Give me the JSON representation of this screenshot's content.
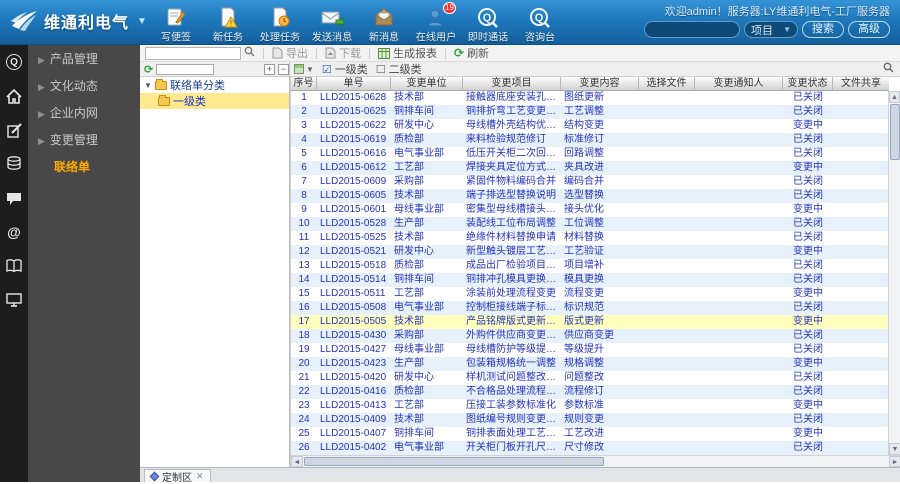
{
  "colors": {
    "header_blue": "#1e78bb",
    "accent_orange": "#ffa800",
    "link_blue": "#2333bd",
    "row_alt": "#e7f1fb",
    "row_highlight": "#ffffbe",
    "tree_selected": "#ffe98f"
  },
  "header": {
    "logo_text": "维通利电气",
    "welcome": "欢迎admin！服务器:LY维通利电气-工厂服务器",
    "search": {
      "value": "",
      "category": "项目",
      "search_btn": "搜索",
      "advanced_btn": "高级"
    },
    "tools": [
      {
        "label": "写便签",
        "badge": ""
      },
      {
        "label": "新任务",
        "badge": ""
      },
      {
        "label": "处理任务",
        "badge": ""
      },
      {
        "label": "发送消息",
        "badge": ""
      },
      {
        "label": "新消息",
        "badge": ""
      },
      {
        "label": "在线用户",
        "badge": "19"
      },
      {
        "label": "即时通话",
        "badge": ""
      },
      {
        "label": "咨询台",
        "badge": ""
      }
    ]
  },
  "sidebar": {
    "items": [
      {
        "label": "产品管理"
      },
      {
        "label": "文化动态"
      },
      {
        "label": "企业内网"
      },
      {
        "label": "变更管理"
      }
    ],
    "active_item": "联络单"
  },
  "content_toolbar": {
    "quick_search_value": "",
    "buttons": [
      {
        "label": "导出",
        "enabled": false
      },
      {
        "label": "下载",
        "enabled": false
      },
      {
        "label": "生成报表",
        "enabled": true
      },
      {
        "label": "刷新",
        "enabled": true
      }
    ],
    "filters": [
      {
        "label": "一级类",
        "checked": true
      },
      {
        "label": "二级类",
        "checked": false
      }
    ]
  },
  "tree": {
    "root": "联络单分类",
    "selected_node": "一级类",
    "filter_value": "",
    "bottom_tab": "定制区"
  },
  "table": {
    "headers": [
      "序号",
      "单号",
      "变更单位",
      "变更项目",
      "变更内容",
      "选择文件",
      "变更通知人",
      "变更状态",
      "文件共享"
    ],
    "highlighted_row_index": 16,
    "rows": [
      [
        "1",
        "LLD2015-0628",
        "技术部",
        "接触器底座安装孔位调整",
        "图纸更新",
        "",
        "",
        "已关闭",
        ""
      ],
      [
        "2",
        "LLD2015-0625",
        "铜排车间",
        "铜排折弯工艺变更通知",
        "工艺调整",
        "",
        "",
        "已关闭",
        ""
      ],
      [
        "3",
        "LLD2015-0622",
        "研发中心",
        "母线槽外壳结构优化方案…",
        "结构变更",
        "",
        "",
        "变更中",
        ""
      ],
      [
        "4",
        "LLD2015-0619",
        "质检部",
        "来料检验规范修订",
        "标准修订",
        "",
        "",
        "已关闭",
        ""
      ],
      [
        "5",
        "LLD2015-0616",
        "电气事业部",
        "低压开关柜二次回路调整…",
        "回路调整",
        "",
        "",
        "已关闭",
        ""
      ],
      [
        "6",
        "LLD2015-0612",
        "工艺部",
        "焊接夹具定位方式改进",
        "夹具改进",
        "",
        "",
        "变更中",
        ""
      ],
      [
        "7",
        "LLD2015-0609",
        "采购部",
        "紧固件物料编码合并",
        "编码合并",
        "",
        "",
        "已关闭",
        ""
      ],
      [
        "8",
        "LLD2015-0605",
        "技术部",
        "端子排选型替换说明",
        "选型替换",
        "",
        "",
        "已关闭",
        ""
      ],
      [
        "9",
        "LLD2015-0601",
        "母线事业部",
        "密集型母线槽接头优化",
        "接头优化",
        "",
        "",
        "变更中",
        ""
      ],
      [
        "10",
        "LLD2015-0528",
        "生产部",
        "装配线工位布局调整",
        "工位调整",
        "",
        "",
        "已关闭",
        ""
      ],
      [
        "11",
        "LLD2015-0525",
        "技术部",
        "绝缘件材料替换申请",
        "材料替换",
        "",
        "",
        "已关闭",
        ""
      ],
      [
        "12",
        "LLD2015-0521",
        "研发中心",
        "新型触头镀层工艺验证…",
        "工艺验证",
        "",
        "",
        "变更中",
        ""
      ],
      [
        "13",
        "LLD2015-0518",
        "质检部",
        "成品出厂检验项目增补",
        "项目增补",
        "",
        "",
        "已关闭",
        ""
      ],
      [
        "14",
        "LLD2015-0514",
        "铜排车间",
        "铜排冲孔模具更换通知",
        "模具更换",
        "",
        "",
        "已关闭",
        ""
      ],
      [
        "15",
        "LLD2015-0511",
        "工艺部",
        "涂装前处理流程变更",
        "流程变更",
        "",
        "",
        "变更中",
        ""
      ],
      [
        "16",
        "LLD2015-0508",
        "电气事业部",
        "控制柜接线端子标识规范",
        "标识规范",
        "",
        "",
        "已关闭",
        ""
      ],
      [
        "17",
        "LLD2015-0505",
        "技术部",
        "产品铭牌版式更新通知",
        "版式更新",
        "",
        "",
        "变更中",
        ""
      ],
      [
        "18",
        "LLD2015-0430",
        "采购部",
        "外购件供应商变更评审",
        "供应商变更",
        "",
        "",
        "已关闭",
        ""
      ],
      [
        "19",
        "LLD2015-0427",
        "母线事业部",
        "母线槽防护等级提升方案…",
        "等级提升",
        "",
        "",
        "已关闭",
        ""
      ],
      [
        "20",
        "LLD2015-0423",
        "生产部",
        "包装箱规格统一调整",
        "规格调整",
        "",
        "",
        "变更中",
        ""
      ],
      [
        "21",
        "LLD2015-0420",
        "研发中心",
        "样机测试问题整改清单",
        "问题整改",
        "",
        "",
        "已关闭",
        ""
      ],
      [
        "22",
        "LLD2015-0416",
        "质检部",
        "不合格品处理流程修订",
        "流程修订",
        "",
        "",
        "已关闭",
        ""
      ],
      [
        "23",
        "LLD2015-0413",
        "工艺部",
        "压接工装参数标准化",
        "参数标准",
        "",
        "",
        "变更中",
        ""
      ],
      [
        "24",
        "LLD2015-0409",
        "技术部",
        "图纸编号规则变更说明",
        "规则变更",
        "",
        "",
        "已关闭",
        ""
      ],
      [
        "25",
        "LLD2015-0407",
        "铜排车间",
        "铜排表面处理工艺改进",
        "工艺改进",
        "",
        "",
        "变更中",
        ""
      ],
      [
        "26",
        "LLD2015-0402",
        "电气事业部",
        "开关柜门板开孔尺寸修改",
        "尺寸修改",
        "",
        "",
        "已关闭",
        ""
      ]
    ]
  }
}
